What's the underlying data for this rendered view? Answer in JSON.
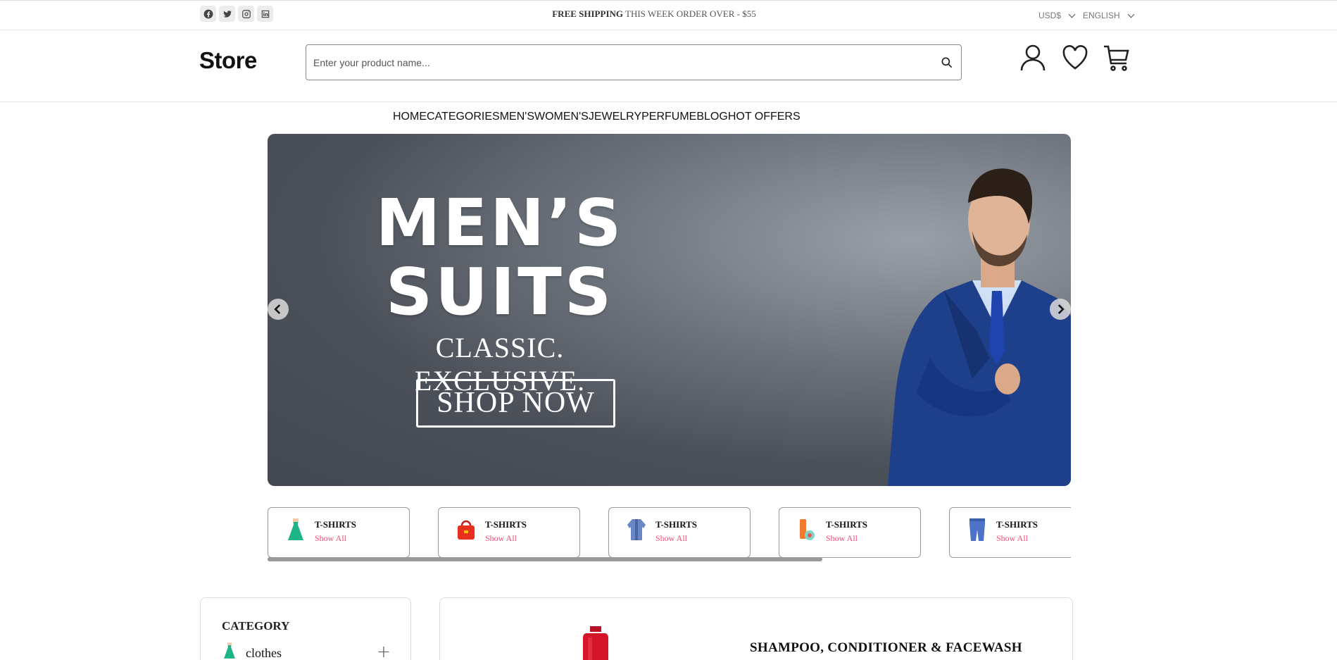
{
  "topbar": {
    "social": [
      "facebook-icon",
      "twitter-icon",
      "instagram-icon",
      "linkedin-icon"
    ],
    "shipping_bold": "FREE SHIPPING",
    "shipping_rest": " THIS WEEK ORDER OVER - $55",
    "currency": "USD$",
    "language": "ENGLISH"
  },
  "header": {
    "logo": "Store",
    "search_placeholder": "Enter your product name...",
    "icons": [
      "user-icon",
      "heart-icon",
      "cart-icon"
    ]
  },
  "nav": {
    "items": [
      "HOME",
      "CATEGORIES",
      "MEN'S",
      "WOMEN'S",
      "JEWELRY",
      "PERFUME",
      "BLOG",
      "HOT OFFERS"
    ]
  },
  "hero": {
    "line1": "MEN’S",
    "line2": "SUITS",
    "subtitle": "CLASSIC. EXCLUSIVE.",
    "cta": "SHOP NOW"
  },
  "categories": [
    {
      "title": "T-SHIRTS",
      "link": "Show All",
      "icon": "dress-icon"
    },
    {
      "title": "T-SHIRTS",
      "link": "Show All",
      "icon": "handbag-icon"
    },
    {
      "title": "T-SHIRTS",
      "link": "Show All",
      "icon": "jacket-icon"
    },
    {
      "title": "T-SHIRTS",
      "link": "Show All",
      "icon": "cosmetics-icon"
    },
    {
      "title": "T-SHIRTS",
      "link": "Show All",
      "icon": "jeans-icon"
    }
  ],
  "sidebar": {
    "heading": "CATEGORY",
    "items": [
      {
        "label": "clothes",
        "icon": "dress-icon"
      }
    ]
  },
  "product": {
    "title": "SHAMPOO, CONDITIONER & FACEWASH"
  },
  "colors": {
    "accent_link": "#e8537a",
    "hero_bg": "#4c5059",
    "suit_blue": "#1e3f8a"
  }
}
